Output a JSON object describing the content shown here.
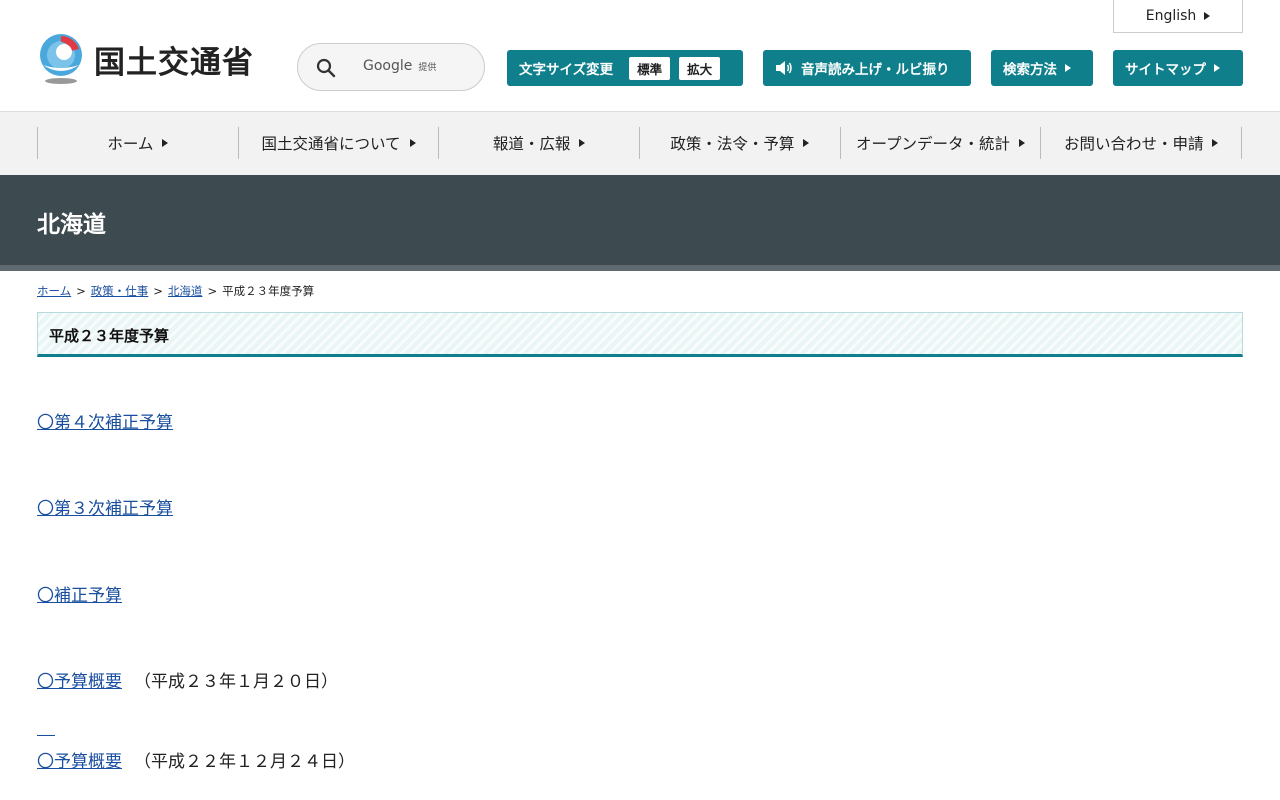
{
  "header": {
    "logo_text": "国土交通省",
    "search_google": "Google",
    "search_provided": "提供",
    "english_label": "English",
    "font_size_label": "文字サイズ変更",
    "font_size_standard": "標準",
    "font_size_large": "拡大",
    "audio_label": "音声読み上げ・ルビ振り",
    "search_method_label": "検索方法",
    "sitemap_label": "サイトマップ",
    "accent_color": "#0f7f8c"
  },
  "nav": {
    "items": [
      {
        "label": "ホーム"
      },
      {
        "label": "国土交通省について"
      },
      {
        "label": "報道・広報"
      },
      {
        "label": "政策・法令・予算"
      },
      {
        "label": "オープンデータ・統計"
      },
      {
        "label": "お問い合わせ・申請"
      }
    ]
  },
  "banner": {
    "title": "北海道",
    "color": "#3d4a50"
  },
  "breadcrumb": {
    "items": [
      {
        "label": "ホーム"
      },
      {
        "label": "政策・仕事"
      },
      {
        "label": "北海道"
      },
      {
        "label": "平成２３年度予算"
      }
    ],
    "separator": ">"
  },
  "page": {
    "heading": "平成２３年度予算",
    "items": [
      {
        "link": "〇第４次補正予算",
        "date": ""
      },
      {
        "link": "〇第３次補正予算",
        "date": ""
      },
      {
        "link": "〇補正予算",
        "date": ""
      },
      {
        "link": "〇予算概要",
        "date": "（平成２３年１月２０日）"
      },
      {
        "link": "〇予算概要",
        "date": "（平成２２年１２月２４日）"
      }
    ]
  }
}
